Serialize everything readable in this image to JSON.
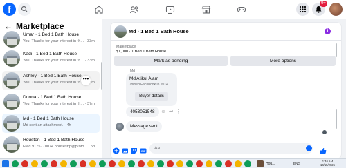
{
  "colors": {
    "brand": "#0866ff",
    "sidebar_active": "#ebf5ff",
    "muted_text": "#65676b",
    "bubble": "#f0f2f5",
    "info_purple": "#8a2be2"
  },
  "topbar": {
    "logo": "f",
    "notification_count": "9+",
    "icons": [
      "facebook-logo",
      "search-icon",
      "home-icon",
      "friends-icon",
      "video-icon",
      "marketplace-icon",
      "gaming-icon",
      "menu-grid-icon",
      "messenger-icon",
      "bell-icon",
      "profile-avatar"
    ]
  },
  "sidebar": {
    "title": "Marketplace",
    "back_icon": "←",
    "more_icon": "•••",
    "conversations": [
      {
        "title": "Umar · 1 Bed 1 Bath House",
        "preview": "You: Thanks for your interest in th...",
        "time": "· 33m",
        "active": false
      },
      {
        "title": "Kadi · 1 Bed 1 Bath House",
        "preview": "You: Thanks for your interest in th...",
        "time": "· 33m",
        "active": false
      },
      {
        "title": "Ashley · 1 Bed 1 Bath House",
        "preview": "You: Thanks for your interest in th...",
        "time": "· 33m",
        "active": false
      },
      {
        "title": "Donna · 1 Bed 1 Bath House",
        "preview": "You: Thanks for your interest in th...",
        "time": "· 37m",
        "active": false
      },
      {
        "title": "Md · 1 Bed 1 Bath House",
        "preview": "Md sent an attachment.",
        "time": "· 4h",
        "active": true
      },
      {
        "title": "Houston · 1 Bed 1 Bath House",
        "preview": "Fred 9175770074 housesnp@proto...",
        "time": "· 5h",
        "active": false
      }
    ]
  },
  "chat": {
    "title": "Md · 1 Bed 1 Bath House",
    "listing_label": "Marketplace",
    "listing_price": "$1,000 · 1 Bed 1 Bath House",
    "mark_pending_label": "Mark as pending",
    "more_options_label": "More options",
    "sender_name": "Md",
    "card_name": "Md Atikul Alam",
    "card_joined": "Joined Facebook in 2014",
    "buyer_details_label": "Buyer details",
    "phone_message": "4053051548",
    "message_sent": "Message sent",
    "composer_placeholder": "Aa"
  },
  "taskbar": {
    "active_window_label": "Hou...",
    "language": "ENG",
    "time": "1:46 AM",
    "date": "10/15/2025"
  }
}
